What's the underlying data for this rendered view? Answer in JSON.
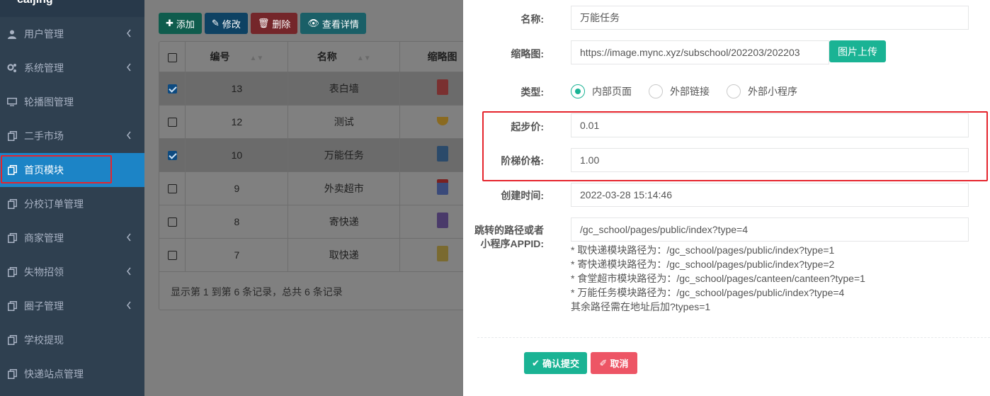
{
  "sidebar": {
    "brand": "caijing",
    "items": [
      {
        "label": "用户管理",
        "icon": "user-icon",
        "has_children": true
      },
      {
        "label": "系统管理",
        "icon": "gears-icon",
        "has_children": true
      },
      {
        "label": "轮播图管理",
        "icon": "desktop-icon",
        "has_children": false
      },
      {
        "label": "二手市场",
        "icon": "copy-icon",
        "has_children": true
      },
      {
        "label": "首页模块",
        "icon": "copy-icon",
        "has_children": false,
        "active": true
      },
      {
        "label": "分校订单管理",
        "icon": "copy-icon",
        "has_children": false
      },
      {
        "label": "商家管理",
        "icon": "copy-icon",
        "has_children": true
      },
      {
        "label": "失物招领",
        "icon": "copy-icon",
        "has_children": true
      },
      {
        "label": "圈子管理",
        "icon": "copy-icon",
        "has_children": true
      },
      {
        "label": "学校提现",
        "icon": "copy-icon",
        "has_children": false
      },
      {
        "label": "快递站点管理",
        "icon": "copy-icon",
        "has_children": false
      }
    ]
  },
  "toolbar": {
    "add_label": "添加",
    "edit_label": "修改",
    "delete_label": "删除",
    "detail_label": "查看详情"
  },
  "table": {
    "columns": [
      "编号",
      "名称",
      "缩略图"
    ],
    "rows": [
      {
        "id": "13",
        "name": "表白墙",
        "checked": true
      },
      {
        "id": "12",
        "name": "测试",
        "checked": false
      },
      {
        "id": "10",
        "name": "万能任务",
        "checked": true
      },
      {
        "id": "9",
        "name": "外卖超市",
        "checked": false
      },
      {
        "id": "8",
        "name": "寄快递",
        "checked": false
      },
      {
        "id": "7",
        "name": "取快递",
        "checked": false
      }
    ],
    "footer": "显示第 1 到第 6 条记录，总共 6 条记录"
  },
  "form": {
    "name_label": "名称:",
    "name_value": "万能任务",
    "thumb_label": "缩略图:",
    "thumb_value": "https://image.mync.xyz/subschool/202203/202203",
    "upload_label": "图片上传",
    "type_label": "类型:",
    "type_options": [
      "内部页面",
      "外部链接",
      "外部小程序"
    ],
    "type_selected": "内部页面",
    "start_price_label": "起步价:",
    "start_price_value": "0.01",
    "step_price_label": "阶梯价格:",
    "step_price_value": "1.00",
    "created_label": "创建时间:",
    "created_value": "2022-03-28 15:14:46",
    "path_label_1": "跳转的路径或者",
    "path_label_2": "小程序APPID:",
    "path_value": "/gc_school/pages/public/index?type=4",
    "hints": [
      "* 取快递模块路径为：/gc_school/pages/public/index?type=1",
      "* 寄快递模块路径为：/gc_school/pages/public/index?type=2",
      "* 食堂超市模块路径为：/gc_school/pages/canteen/canteen?type=1",
      "* 万能任务模块路径为：/gc_school/pages/public/index?type=4",
      "其余路径需在地址后加?types=1"
    ],
    "submit_label": "确认提交",
    "cancel_label": "取消"
  }
}
